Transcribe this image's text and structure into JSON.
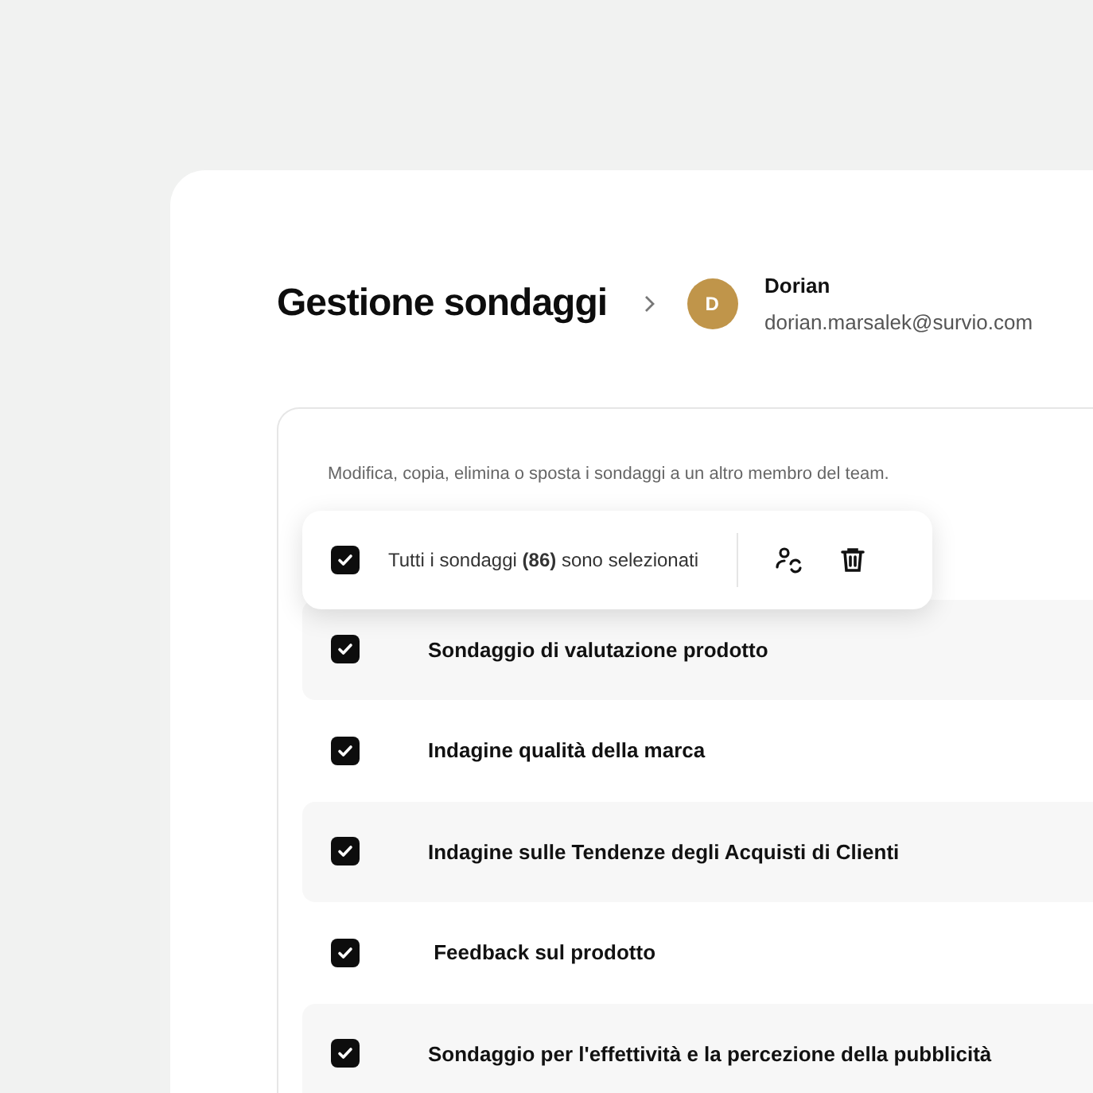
{
  "header": {
    "title": "Gestione sondaggi",
    "user": {
      "initial": "D",
      "name": "Dorian",
      "email": "dorian.marsalek@survio.com"
    }
  },
  "panel": {
    "description": "Modifica, copia, elimina o sposta i sondaggi a un altro membro del team.",
    "selection_bar": {
      "checked": true,
      "text": "Tutti i sondaggi **(86)** sono selezionati"
    },
    "surveys": [
      {
        "title": "Sondaggio di valutazione prodotto",
        "checked": true
      },
      {
        "title": "Indagine qualità della marca",
        "checked": true
      },
      {
        "title": "Indagine sulle Tendenze degli Acquisti di Clienti",
        "checked": true
      },
      {
        "title": " Feedback sul prodotto",
        "checked": true
      },
      {
        "title": "Sondaggio per l'effettività e la percezione della pubblicità",
        "checked": true
      }
    ]
  }
}
